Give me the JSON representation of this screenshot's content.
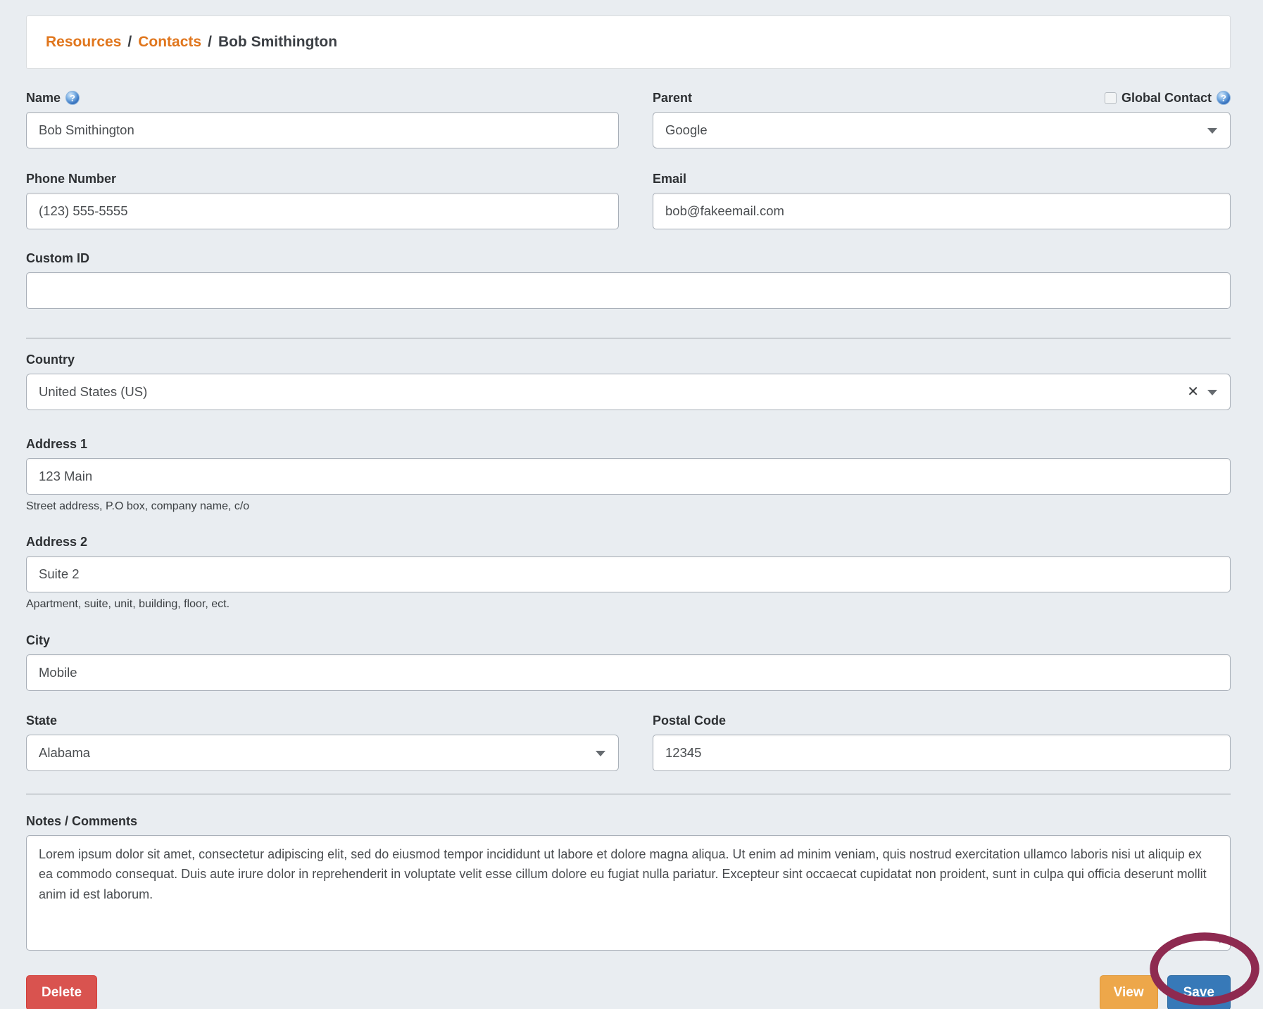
{
  "breadcrumb": {
    "separator": "/",
    "items": [
      {
        "label": "Resources"
      },
      {
        "label": "Contacts"
      },
      {
        "label": "Bob Smithington"
      }
    ]
  },
  "form": {
    "name": {
      "label": "Name",
      "value": "Bob Smithington"
    },
    "parent": {
      "label": "Parent",
      "value": "Google"
    },
    "global_contact": {
      "label": "Global Contact",
      "checked": false
    },
    "phone": {
      "label": "Phone Number",
      "value": "(123) 555-5555"
    },
    "email": {
      "label": "Email",
      "value": "bob@fakeemail.com"
    },
    "custom_id": {
      "label": "Custom ID",
      "value": ""
    },
    "country": {
      "label": "Country",
      "value": "United States (US)",
      "clear_glyph": "✕"
    },
    "address1": {
      "label": "Address 1",
      "value": "123 Main",
      "helper": "Street address, P.O box, company name, c/o"
    },
    "address2": {
      "label": "Address 2",
      "value": "Suite 2",
      "helper": "Apartment, suite, unit, building, floor, ect."
    },
    "city": {
      "label": "City",
      "value": "Mobile"
    },
    "state": {
      "label": "State",
      "value": "Alabama"
    },
    "postal": {
      "label": "Postal Code",
      "value": "12345"
    },
    "notes": {
      "label": "Notes / Comments",
      "value": "Lorem ipsum dolor sit amet, consectetur adipiscing elit, sed do eiusmod tempor incididunt ut labore et dolore magna aliqua. Ut enim ad minim veniam, quis nostrud exercitation ullamco laboris nisi ut aliquip ex ea commodo consequat. Duis aute irure dolor in reprehenderit in voluptate velit esse cillum dolore eu fugiat nulla pariatur. Excepteur sint occaecat cupidatat non proident, sunt in culpa qui officia deserunt mollit anim id est laborum."
    }
  },
  "buttons": {
    "delete": "Delete",
    "view": "View",
    "save": "Save"
  },
  "icons": {
    "help_glyph": "?"
  },
  "colors": {
    "page_bg": "#e9edf1",
    "breadcrumb_link": "#e0761d",
    "delete_red": "#d9534f",
    "view_orange": "#eda74a",
    "save_blue": "#3779b8",
    "annotation_ellipse": "#8e2a50"
  }
}
